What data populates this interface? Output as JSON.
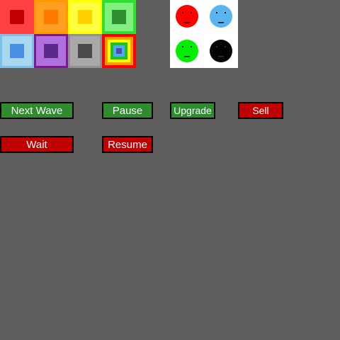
{
  "towers": [
    {
      "name": "red",
      "outer": "#ff4040",
      "border": "#ff4040",
      "inner": "#c00000"
    },
    {
      "name": "orange",
      "outer": "#ffa020",
      "border": "#ff9800",
      "inner": "#ff7a00"
    },
    {
      "name": "yellow",
      "outer": "#ffff40",
      "border": "#ffff00",
      "inner": "#ffd000"
    },
    {
      "name": "green",
      "outer": "#80f080",
      "border": "#30e030",
      "inner": "#2f8f2f"
    },
    {
      "name": "blue",
      "outer": "#a8d8f0",
      "border": "#7ec0ea",
      "inner": "#4a90e2"
    },
    {
      "name": "purple",
      "outer": "#b070e0",
      "border": "#7a1a8a",
      "inner": "#5a2a8a"
    },
    {
      "name": "gray",
      "outer": "#a8a8a8",
      "border": "#909090",
      "inner": "#4a4a4a"
    },
    {
      "name": "rainbow",
      "outer": "#ff0000",
      "border": "#ff0000",
      "inner": "#4a4ab0"
    }
  ],
  "enemies": [
    {
      "name": "red-face",
      "color": "#ff0000"
    },
    {
      "name": "blue-face",
      "color": "#5ab4f0"
    },
    {
      "name": "green-face",
      "color": "#00ee00"
    },
    {
      "name": "black-face",
      "color": "#000000"
    }
  ],
  "buttons": {
    "next_wave": {
      "label": "Next Wave",
      "color": "#2e8b2e"
    },
    "pause": {
      "label": "Pause",
      "color": "#2e8b2e"
    },
    "upgrade": {
      "label": "Upgrade",
      "color": "#2e8b2e"
    },
    "sell": {
      "label": "Sell",
      "color": "#c00000"
    },
    "wait": {
      "label": "Wait",
      "color": "#c00000"
    },
    "resume": {
      "label": "Resume",
      "color": "#c00000"
    }
  }
}
